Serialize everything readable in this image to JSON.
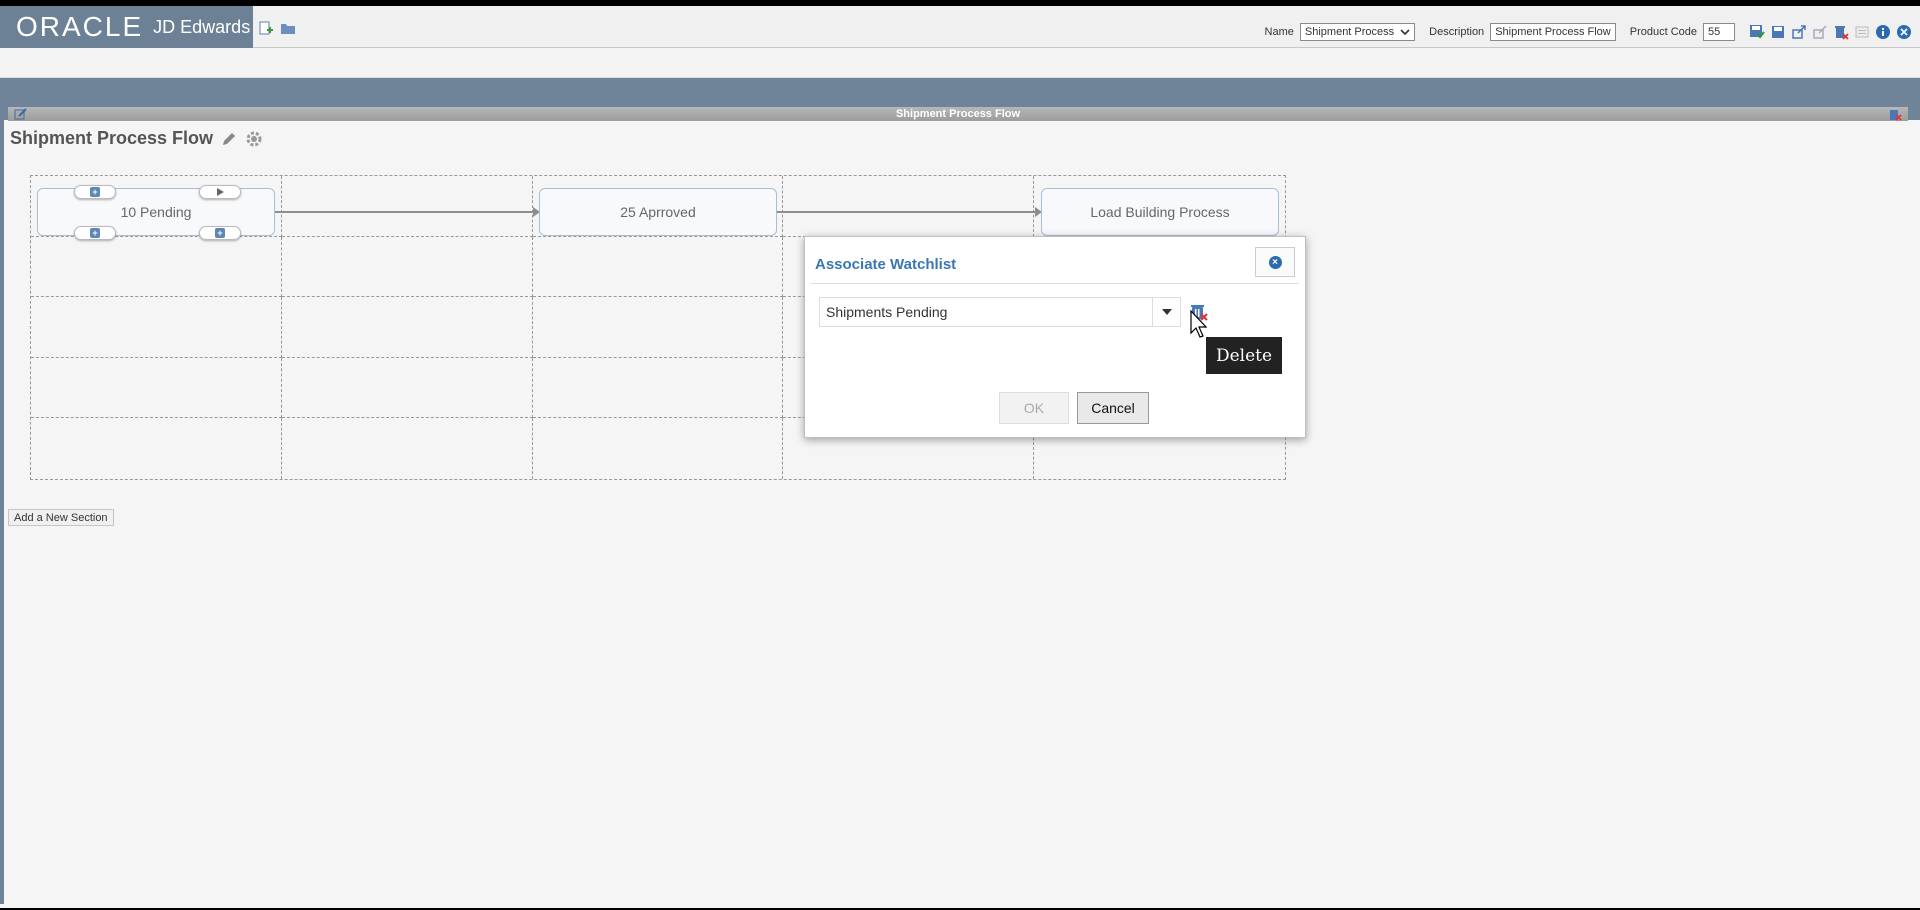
{
  "brand": {
    "oracle": "ORACLE",
    "product": "JD Edwards"
  },
  "toolbar": {
    "name_label": "Name",
    "name_value": "Shipment Process",
    "description_label": "Description",
    "description_value": "Shipment Process Flow",
    "product_code_label": "Product Code",
    "product_code_value": "55"
  },
  "panel": {
    "title": "Shipment Process Flow"
  },
  "flow": {
    "title": "Shipment Process Flow",
    "nodes": [
      "10 Pending",
      "25 Aprroved",
      "Load Building Process"
    ],
    "add_section": "Add a New Section"
  },
  "dialog": {
    "title": "Associate Watchlist",
    "selected_watchlist": "Shipments Pending",
    "ok_label": "OK",
    "cancel_label": "Cancel"
  },
  "tooltip": {
    "text": "Delete"
  },
  "colors": {
    "brand_bar": "#6d8196",
    "band": "#6f8499",
    "dialog_title": "#3a77b0",
    "node_border": "#a7bedb"
  },
  "icons": [
    "new-icon",
    "open-folder-icon",
    "save-and-close-icon",
    "save-icon",
    "export-icon",
    "import-icon",
    "delete-icon",
    "form-icon",
    "info-icon",
    "close-icon",
    "pencil-icon",
    "gear-icon",
    "trash-icon"
  ]
}
